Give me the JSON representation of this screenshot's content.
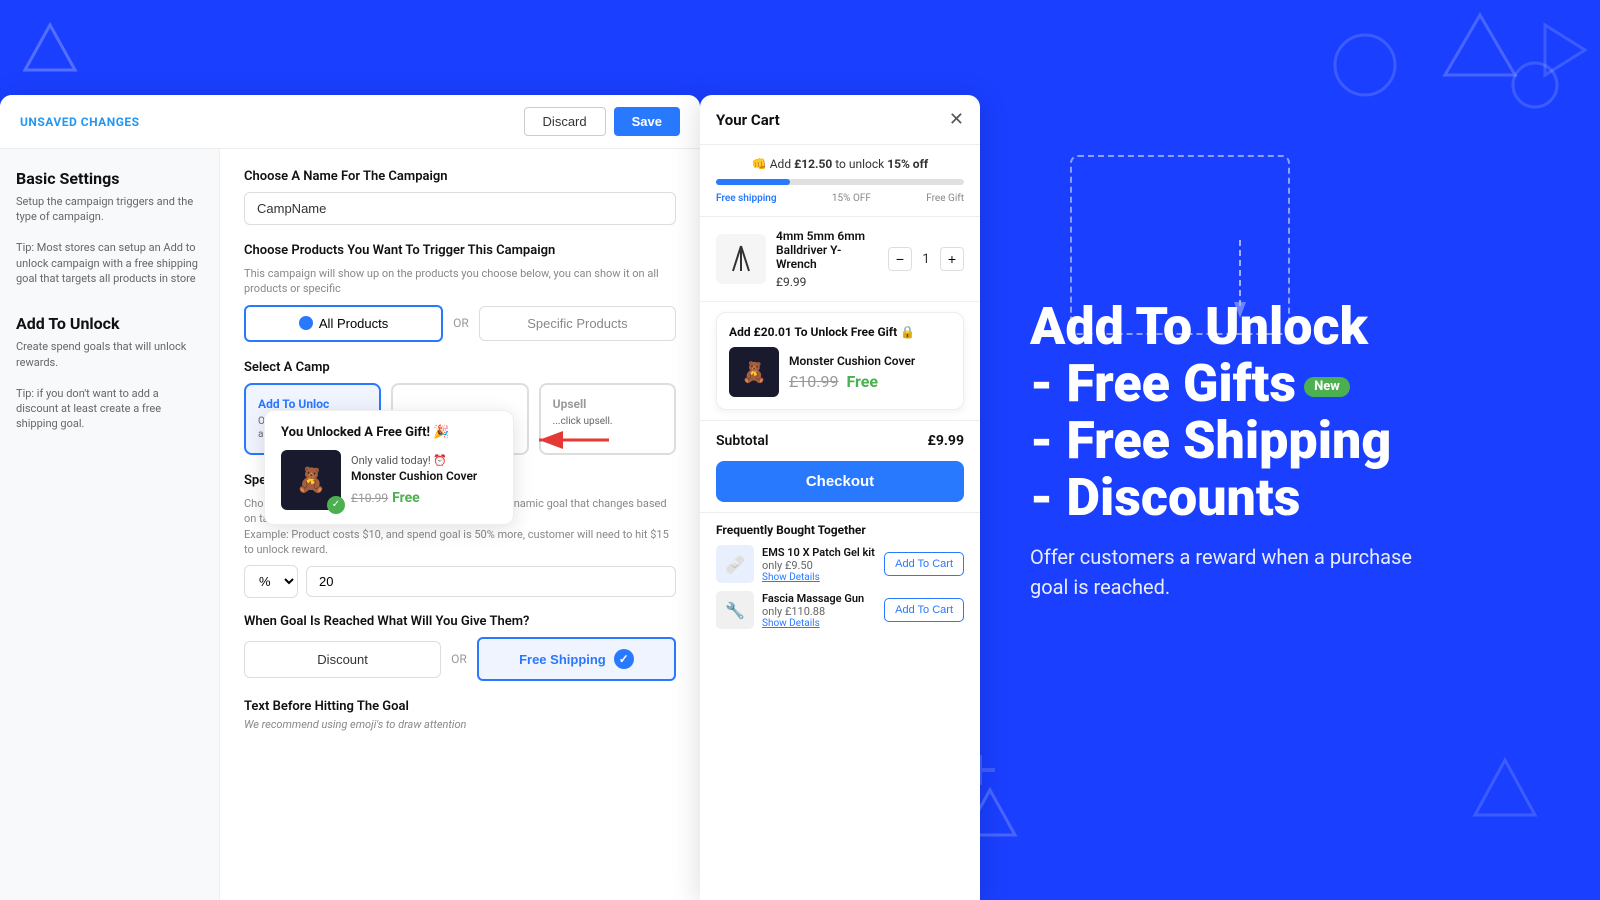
{
  "unsaved": {
    "label": "UNSAVED CHANGES",
    "discard_btn": "Discard",
    "save_btn": "Save"
  },
  "sidebar": {
    "basic_settings": {
      "title": "Basic Settings",
      "desc": "Setup the campaign triggers and the type of campaign.\nTip: Most stores can setup an Add to unlock campaign with a free shipping goal that targets all products in store"
    },
    "add_to_unlock": {
      "title": "Add To Unlock",
      "desc": "Create spend goals that will unlock rewards.\nTip: If you don't want to add a discount at least create a free shipping goal."
    }
  },
  "form": {
    "campaign_name_label": "Choose A Name For The Campaign",
    "campaign_name_value": "CampName",
    "products_label": "Choose Products You Want To Trigger This Campaign",
    "products_sublabel": "This campaign will show up on the products you choose below, you can show it on all products or specific",
    "all_products_btn": "All Products",
    "specific_products_btn": "Specific Products",
    "or_text": "OR",
    "select_campaign_label": "Select A Camp",
    "campaign_cards": [
      {
        "title": "Add To Unloc",
        "desc": "Offer customers... when a purchase... hit.",
        "active": true
      },
      {
        "title": "",
        "desc": "",
        "active": false
      },
      {
        "title": "Upsell",
        "desc": "...click upsell.",
        "active": false
      }
    ],
    "spend_goal_label": "Spend Goal",
    "spend_goal_sublabel": "Choose the goal that will unlock your reward. (X) is a dynamic goal that changes based on target product's price.\nExample: Product costs $10, and spend goal is 50% more, customer will need to hit $15 to unlock reward.",
    "percent_value": "%",
    "spend_value": "20",
    "reward_label": "When Goal Is Reached What Will You Give Them?",
    "or_label": "OR",
    "discount_btn": "Discount",
    "free_shipping_btn": "Free Shipping",
    "text_before_label": "Text Before Hitting The Goal",
    "text_before_sublabel": "We recommend using emoji's to draw attention"
  },
  "popup": {
    "title": "You Unlocked A Free Gift! 🎉",
    "validity": "Only valid today! ⏰",
    "product_name": "Monster Cushion Cover",
    "price_orig": "£10.99",
    "price_free": "Free"
  },
  "cart": {
    "title": "Your Cart",
    "progress_text_prefix": "👊 Add",
    "progress_amount": "£12.50",
    "progress_text_suffix": "to unlock",
    "progress_percent": "15% off",
    "milestone_1": "Free shipping",
    "milestone_2": "15% OFF",
    "milestone_3": "Free Gift",
    "item": {
      "name": "4mm 5mm 6mm Balldriver Y-Wrench",
      "price": "£9.99",
      "qty": "1"
    },
    "free_gift_card": {
      "title": "Add £20.01 To Unlock Free Gift 🔒",
      "product_name": "Monster Cushion Cover",
      "price_orig": "£10.99",
      "price_free": "Free"
    },
    "subtotal_label": "Subtotal",
    "subtotal_value": "£9.99",
    "checkout_btn": "Checkout",
    "fbt_title": "Frequently Bought Together",
    "fbt_items": [
      {
        "name": "EMS 10 X Patch Gel kit",
        "price": "only £9.50",
        "show_details": "Show Details",
        "add_btn": "Add To Cart"
      },
      {
        "name": "Fascia Massage Gun",
        "price": "only £110.88",
        "show_details": "Show Details",
        "add_btn": "Add To Cart"
      }
    ]
  },
  "marketing": {
    "line1": "Add To Unlock",
    "line2": "- Free Gifts",
    "new_badge": "New",
    "line3": "- Free Shipping",
    "line4": "- Discounts",
    "subtitle": "Offer customers a reward when a purchase goal is reached."
  },
  "colors": {
    "primary": "#2979FF",
    "bg": "#1a3fff",
    "green": "#4CAF50"
  }
}
